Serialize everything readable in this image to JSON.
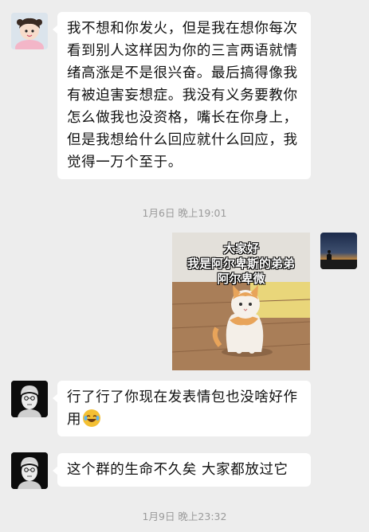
{
  "messages": [
    {
      "text": "我不想和你发火，但是我在想你每次看到别人这样因为你的三言两语就情绪高涨是不是很兴奋。最后搞得像我有被迫害妄想症。我没有义务要教你怎么做我也没资格，嘴长在你身上，但是我想给什么回应就什么回应，我觉得一万个至于。"
    },
    {
      "caption": [
        "大家好",
        "我是阿尔卑斯的弟弟",
        "阿尔卑微"
      ]
    },
    {
      "text": "行了行了你现在发表情包也没啥好作用"
    },
    {
      "text": "这个群的生命不久矣 大家都放过它"
    }
  ],
  "timestamps": [
    "1月6日 晚上19:01",
    "1月9日 晚上23:32"
  ],
  "icons": {
    "emoji": "laughing-crying-emoji"
  }
}
